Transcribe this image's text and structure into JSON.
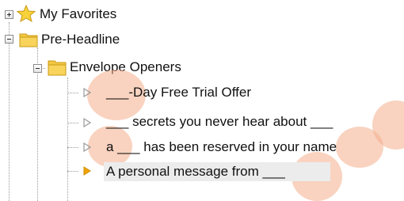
{
  "tree": {
    "nodes": [
      {
        "label": "My Favorites",
        "icon": "star-icon",
        "state": "collapsed"
      },
      {
        "label": "Pre-Headline",
        "icon": "folder-icon",
        "state": "expanded"
      },
      {
        "label": "Envelope Openers",
        "icon": "folder-icon",
        "state": "expanded"
      },
      {
        "label": "___-Day Free Trial Offer",
        "icon": "triangle-outline-icon"
      },
      {
        "label": "___ secrets you never hear about ___",
        "icon": "triangle-outline-icon"
      },
      {
        "label": "a ___ has been reserved in your name",
        "icon": "triangle-outline-icon"
      },
      {
        "label": "A personal message from ___",
        "icon": "triangle-filled-icon",
        "selected": true
      }
    ]
  },
  "colors": {
    "highlight": "#f4af8c",
    "folder": "#f5c842",
    "star": "#f7d23a",
    "selected_arrow": "#f0a500",
    "outline_arrow": "#9a9a9a"
  }
}
